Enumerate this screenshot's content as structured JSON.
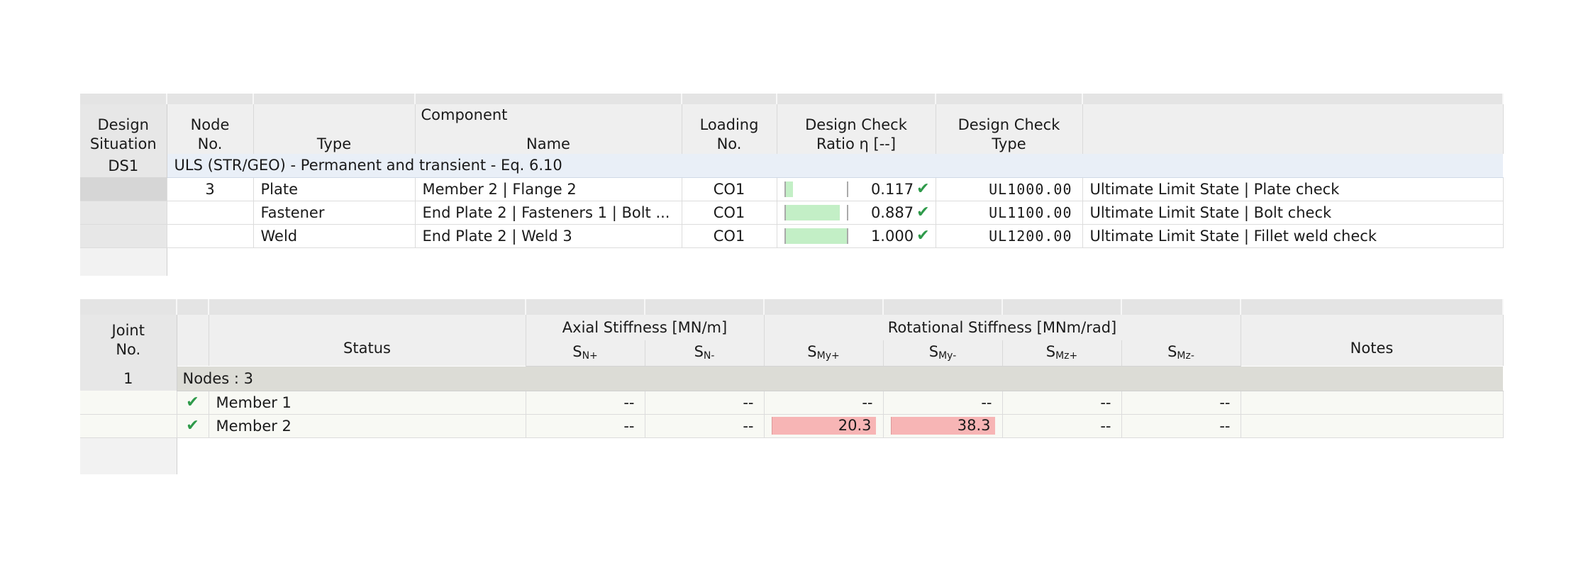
{
  "t1": {
    "headers": {
      "design_situation": [
        "Design",
        "Situation"
      ],
      "node_no": [
        "Node",
        "No."
      ],
      "component": "Component",
      "type": "Type",
      "name": "Name",
      "loading_no": [
        "Loading",
        "No."
      ],
      "ratio": [
        "Design Check",
        "Ratio η [--]"
      ],
      "check_type": [
        "Design Check",
        "Type"
      ]
    },
    "situation": {
      "id": "DS1",
      "label": "ULS (STR/GEO) - Permanent and transient - Eq. 6.10"
    },
    "rows": [
      {
        "node": "3",
        "type": "Plate",
        "name": "Member 2 | Flange 2",
        "loading": "CO1",
        "ratio": "0.117",
        "ratio_fraction": 0.117,
        "code": "UL1000.00",
        "desc": "Ultimate Limit State | Plate check"
      },
      {
        "node": "",
        "type": "Fastener",
        "name": "End Plate 2 | Fasteners 1 | Bolt ...",
        "loading": "CO1",
        "ratio": "0.887",
        "ratio_fraction": 0.887,
        "code": "UL1100.00",
        "desc": "Ultimate Limit State | Bolt check"
      },
      {
        "node": "",
        "type": "Weld",
        "name": "End Plate 2 | Weld 3",
        "loading": "CO1",
        "ratio": "1.000",
        "ratio_fraction": 1.0,
        "code": "UL1200.00",
        "desc": "Ultimate Limit State | Fillet weld check"
      }
    ]
  },
  "t2": {
    "headers": {
      "joint_no": [
        "Joint",
        "No."
      ],
      "status": "Status",
      "axial": "Axial Stiffness [MN/m]",
      "rotational": "Rotational Stiffness [MNm/rad]",
      "sn_plus": {
        "base": "S",
        "sub": "N+"
      },
      "sn_minus": {
        "base": "S",
        "sub": "N-"
      },
      "smy_plus": {
        "base": "S",
        "sub": "My+"
      },
      "smy_minus": {
        "base": "S",
        "sub": "My-"
      },
      "smz_plus": {
        "base": "S",
        "sub": "Mz+"
      },
      "smz_minus": {
        "base": "S",
        "sub": "Mz-"
      },
      "notes": "Notes"
    },
    "joint": {
      "no": "1",
      "nodes": "Nodes : 3"
    },
    "rows": [
      {
        "member": "Member 1",
        "sn_plus": "--",
        "sn_minus": "--",
        "smy_plus": "--",
        "smy_minus": "--",
        "smz_plus": "--",
        "smz_minus": "--"
      },
      {
        "member": "Member 2",
        "sn_plus": "--",
        "sn_minus": "--",
        "smy_plus": "20.3",
        "smy_minus": "38.3",
        "smz_plus": "--",
        "smz_minus": "--"
      }
    ]
  },
  "icons": {
    "check": "✔"
  },
  "colors": {
    "ok": "#2e9a4a",
    "ratio_fill": "#c3efc6",
    "highlight": "#f7b5b5",
    "situation_band": "#e9eff7"
  }
}
